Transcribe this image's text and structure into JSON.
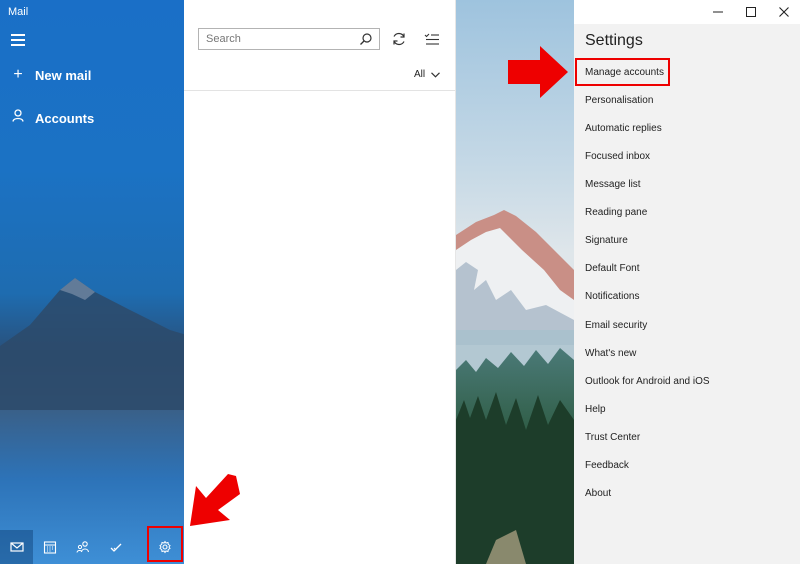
{
  "app": {
    "title": "Mail"
  },
  "sidebar": {
    "new_mail": "New mail",
    "accounts": "Accounts",
    "bottom_icons": [
      "mail-icon",
      "calendar-icon",
      "people-icon",
      "todo-icon",
      "gear-icon"
    ]
  },
  "message_list": {
    "search_placeholder": "Search",
    "filter_label": "All"
  },
  "settings": {
    "title": "Settings",
    "items": [
      "Manage accounts",
      "Personalisation",
      "Automatic replies",
      "Focused inbox",
      "Message list",
      "Reading pane",
      "Signature",
      "Default Font",
      "Notifications",
      "Email security",
      "What's new",
      "Outlook for Android and iOS",
      "Help",
      "Trust Center",
      "Feedback",
      "About"
    ]
  },
  "colors": {
    "accent": "#1a6fc7",
    "highlight": "#e00000",
    "settings_bg": "#f2f2f2"
  }
}
